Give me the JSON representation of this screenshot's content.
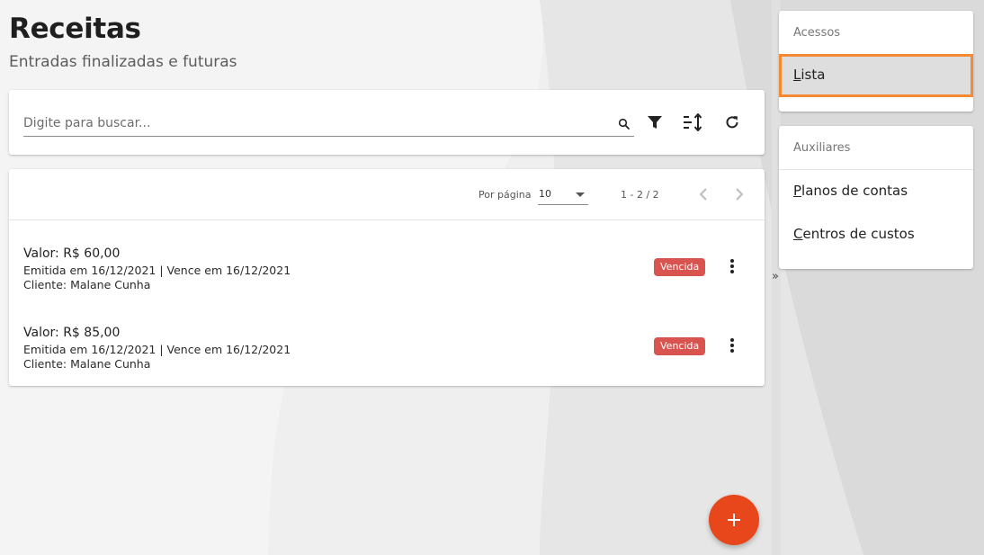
{
  "page": {
    "title": "Receitas",
    "subtitle": "Entradas finalizadas e futuras"
  },
  "search": {
    "placeholder": "Digite para buscar...",
    "value": ""
  },
  "toolbar": {
    "icons": [
      "search-icon",
      "filter-icon",
      "sort-icon",
      "refresh-icon"
    ]
  },
  "pagination": {
    "per_page_label": "Por página",
    "per_page_value": "10",
    "range": "1 - 2 / 2"
  },
  "items": [
    {
      "value": "Valor: R$ 60,00",
      "dates": "Emitida em 16/12/2021 | Vence em 16/12/2021",
      "client": "Cliente: Malane Cunha",
      "status": "Vencida"
    },
    {
      "value": "Valor: R$ 85,00",
      "dates": "Emitida em 16/12/2021 | Vence em 16/12/2021",
      "client": "Cliente: Malane Cunha",
      "status": "Vencida"
    }
  ],
  "fab": {
    "label": "+"
  },
  "sidebar": {
    "collapse_label": "»",
    "acessos": {
      "header": "Acessos",
      "items": [
        {
          "first": "L",
          "rest": "ista"
        }
      ]
    },
    "auxiliares": {
      "header": "Auxiliares",
      "items": [
        {
          "first": "P",
          "rest": "lanos de contas"
        },
        {
          "first": "C",
          "rest": "entros de custos"
        }
      ]
    }
  },
  "colors": {
    "accent": "#e8471b",
    "badge": "#d9534f",
    "highlight": "#f58a32"
  }
}
